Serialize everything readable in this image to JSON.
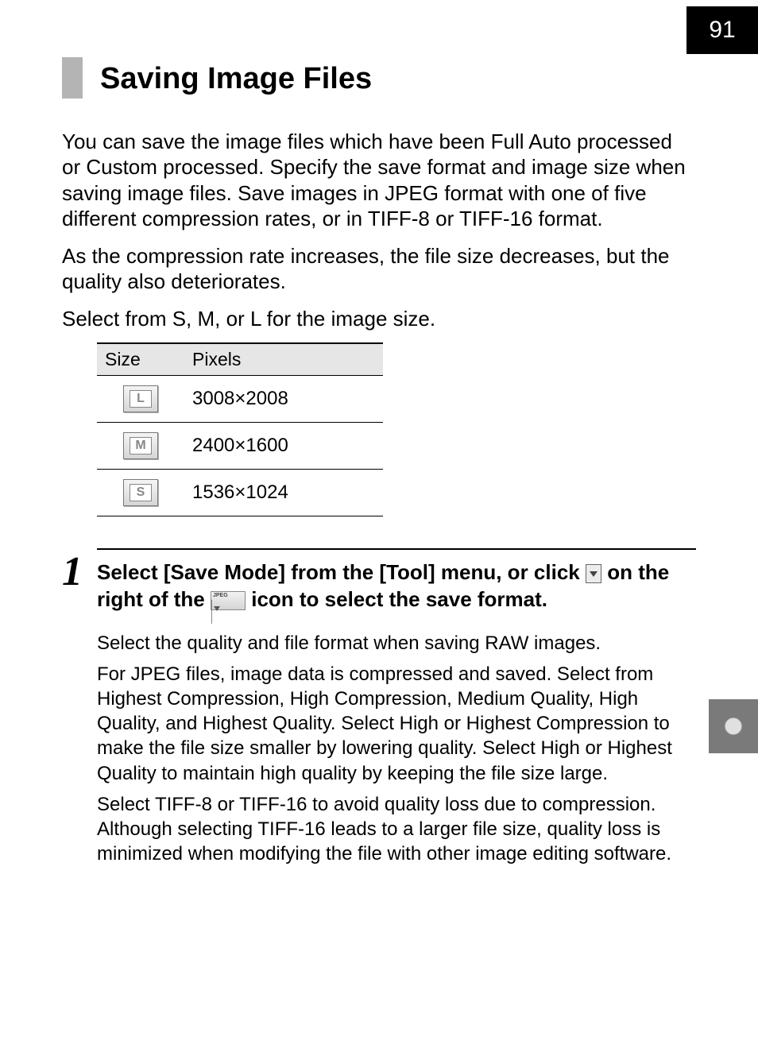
{
  "page_number": "91",
  "heading": "Saving Image Files",
  "intro": {
    "p1": "You can save the image files which have been Full Auto processed or Custom processed. Specify the save format and image size when saving image files. Save images in JPEG format with one of five different compression rates, or in TIFF-8 or TIFF-16 format.",
    "p2": "As the compression rate increases, the file size decreases, but the quality also deteriorates.",
    "p3": "Select from S, M, or L for the image size."
  },
  "table": {
    "col1": "Size",
    "col2": "Pixels",
    "rows": [
      {
        "icon_letter": "L",
        "pixels": "3008×2008"
      },
      {
        "icon_letter": "M",
        "pixels": "2400×1600"
      },
      {
        "icon_letter": "S",
        "pixels": "1536×1024"
      }
    ]
  },
  "step": {
    "number": "1",
    "headline_a": "Select [Save Mode] from the [Tool] menu, or click ",
    "headline_b": " on the right of the ",
    "headline_c": " icon to select the save format.",
    "body_p1": "Select the quality and file format when saving RAW images.",
    "body_p2": "For JPEG files, image data is compressed and saved. Select from Highest Compression, High Compression, Medium Quality, High Quality, and Highest Quality. Select High or Highest Compression to make the file size smaller by lowering quality. Select High or Highest Quality to maintain high quality by keeping the file size large.",
    "body_p3": "Select TIFF-8 or TIFF-16 to avoid quality loss due to compression. Although selecting TIFF-16 leads to a larger file size, quality loss is minimized when modifying the file with other image editing software."
  }
}
